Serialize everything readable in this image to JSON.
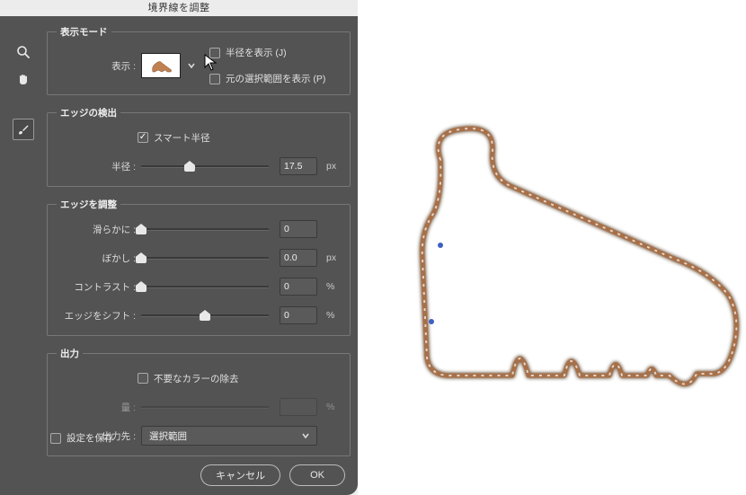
{
  "dialog_title": "境界線を調整",
  "sections": {
    "view_mode": {
      "legend": "表示モード",
      "display_label": "表示 :",
      "show_radius": {
        "checked": false,
        "label": "半径を表示 (J)"
      },
      "show_original": {
        "checked": false,
        "label": "元の選択範囲を表示 (P)"
      }
    },
    "edge_detect": {
      "legend": "エッジの検出",
      "smart_radius": {
        "checked": true,
        "label": "スマート半径"
      },
      "radius": {
        "label": "半径 :",
        "value": "17.5",
        "unit": "px",
        "pos": 38
      }
    },
    "edge_adjust": {
      "legend": "エッジを調整",
      "smooth": {
        "label": "滑らかに :",
        "value": "0",
        "unit": "",
        "pos": 0
      },
      "feather": {
        "label": "ぼかし :",
        "value": "0.0",
        "unit": "px",
        "pos": 0
      },
      "contrast": {
        "label": "コントラスト :",
        "value": "0",
        "unit": "%",
        "pos": 0
      },
      "shift": {
        "label": "エッジをシフト :",
        "value": "0",
        "unit": "%",
        "pos": 50
      }
    },
    "output": {
      "legend": "出力",
      "decontaminate": {
        "checked": false,
        "label": "不要なカラーの除去"
      },
      "amount": {
        "label": "量 :",
        "value": "",
        "unit": "%",
        "pos": 0,
        "disabled": true
      },
      "output_to": {
        "label": "出力先 :",
        "value": "選択範囲"
      }
    }
  },
  "save_settings": {
    "checked": false,
    "label": "設定を保存"
  },
  "buttons": {
    "cancel": "キャンセル",
    "ok": "OK"
  },
  "tools": {
    "zoom": "zoom-icon",
    "hand": "hand-icon",
    "brush": "brush-icon"
  }
}
